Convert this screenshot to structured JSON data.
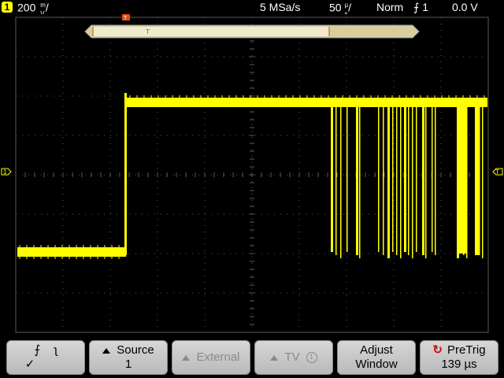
{
  "status": {
    "channel": "1",
    "volts_per_div": "200",
    "volts_unit_top": "m",
    "volts_unit_bottom": "V",
    "sample_rate": "5 MSa/s",
    "time_per_div": "50",
    "time_unit_top": "µ",
    "time_unit_bottom": "s",
    "trigger_mode": "Norm",
    "trigger_source": "1",
    "trigger_level": "0.0 V"
  },
  "markers": {
    "trigger_pos_label": "T",
    "left_channel": "1",
    "right_level": "T"
  },
  "softkeys": [
    {
      "label": "",
      "sub": "✓"
    },
    {
      "label": "Source",
      "sub": "1"
    },
    {
      "label": "External",
      "sub": ""
    },
    {
      "label": "TV",
      "badge": "1",
      "sub": ""
    },
    {
      "label": "Adjust",
      "sub": "Window"
    },
    {
      "label": "PreTrig",
      "sub": "139 µs"
    }
  ],
  "colors": {
    "trace": "#ffff00",
    "grid": "#5a5a5a",
    "badge_bg": "#ffff00"
  }
}
